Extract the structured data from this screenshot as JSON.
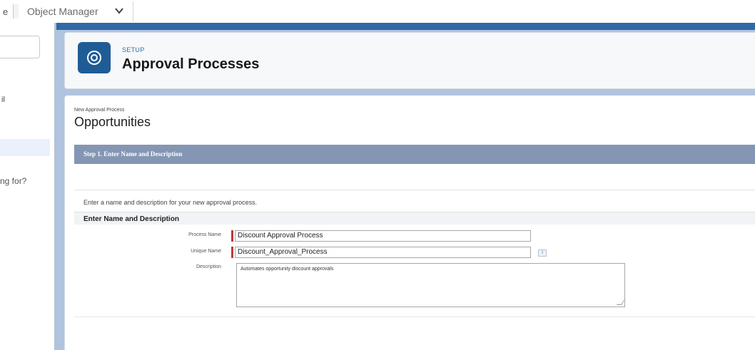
{
  "topbar": {
    "edge_fragment": "e",
    "object_manager_label": "Object Manager",
    "chevron_icon": "chevron-down-icon"
  },
  "sidebar": {
    "fragment_1": "il",
    "fragment_2": "ng for?"
  },
  "header": {
    "eyebrow": "SETUP",
    "title": "Approval Processes",
    "icon": "gear-icon"
  },
  "page": {
    "breadcrumb": "New Approval Process",
    "title": "Opportunities",
    "step_title": "Step 1. Enter Name and Description",
    "intro": "Enter a name and description for your new approval process.",
    "section_title": "Enter Name and Description"
  },
  "form": {
    "process_name_label": "Process Name",
    "process_name_value": "Discount Approval Process",
    "unique_name_label": "Unique Name",
    "unique_name_value": "Discount_Approval_Process",
    "info_icon_glyph": "i",
    "description_label": "Description",
    "description_value": "Automates opportunity discount approvals"
  },
  "colors": {
    "brand_blue": "#1f5c96",
    "step_bar": "#8496b3",
    "required": "#c23934"
  }
}
